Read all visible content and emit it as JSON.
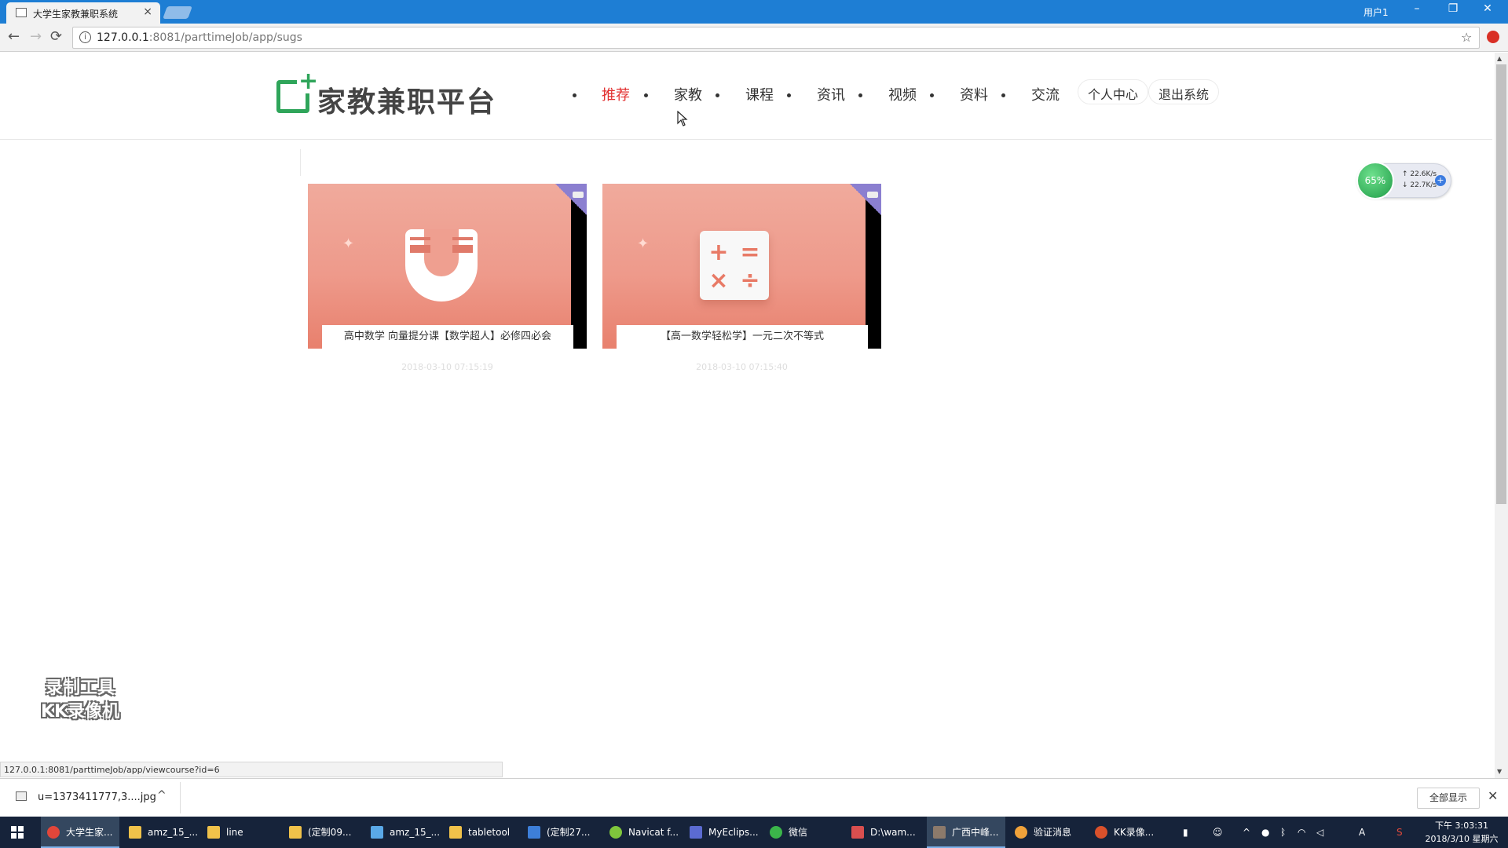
{
  "browser": {
    "tab_title": "大学生家教兼职系统",
    "tab_close": "×",
    "user_label": "用户1",
    "win_min": "–",
    "win_restore": "❐",
    "win_close": "✕",
    "back": "←",
    "forward": "→",
    "reload": "⟳",
    "url_host": "127.0.0.1",
    "url_path": ":8081/parttimeJob/app/sugs",
    "star": "☆"
  },
  "site": {
    "logo_text": "家教兼职平台",
    "logo_plus": "+",
    "nav": [
      "推荐",
      "家教",
      "课程",
      "资讯",
      "视频",
      "资料",
      "交流"
    ],
    "nav_active_color": "#e23030",
    "user_center": "个人中心",
    "logout": "退出系统"
  },
  "courses": [
    {
      "title": "高中数学 向量提分课【数学超人】必修四必会",
      "date": "2018-03-10 07:15:19",
      "icon": "magnet-icon"
    },
    {
      "title": "【高一数学轻松学】一元二次不等式",
      "date": "2018-03-10 07:15:40",
      "icon": "calculator-icon"
    }
  ],
  "math_symbols": [
    "+",
    "=",
    "×",
    "÷"
  ],
  "speed_widget": {
    "percent": "65%",
    "up": "↑ 22.6K/s",
    "down": "↓ 22.7K/s",
    "plus": "+"
  },
  "watermark": {
    "line1": "录制工具",
    "line2": "KK录像机"
  },
  "status_url": "127.0.0.1:8081/parttimeJob/app/viewcourse?id=6",
  "download": {
    "file": "u=1373411777,3....jpg",
    "caret": "^",
    "show_all": "全部显示",
    "close": "✕"
  },
  "taskbar": {
    "items": [
      "大学生家...",
      "amz_15_...",
      "line",
      "(定制09...",
      "amz_15_...",
      "tabletool",
      "(定制27...",
      "Navicat f...",
      "MyEclips...",
      "微信",
      "D:\\wam...",
      "广西中峰...",
      "验证消息",
      "KK录像..."
    ],
    "tray_lang": "A",
    "tray_caret": "^",
    "clock_time": "下午 3:03:31",
    "clock_date": "2018/3/10 星期六"
  },
  "colors": {
    "accent": "#2fa55a",
    "titlebar": "#1e7ed4",
    "taskbar": "#16233a"
  }
}
